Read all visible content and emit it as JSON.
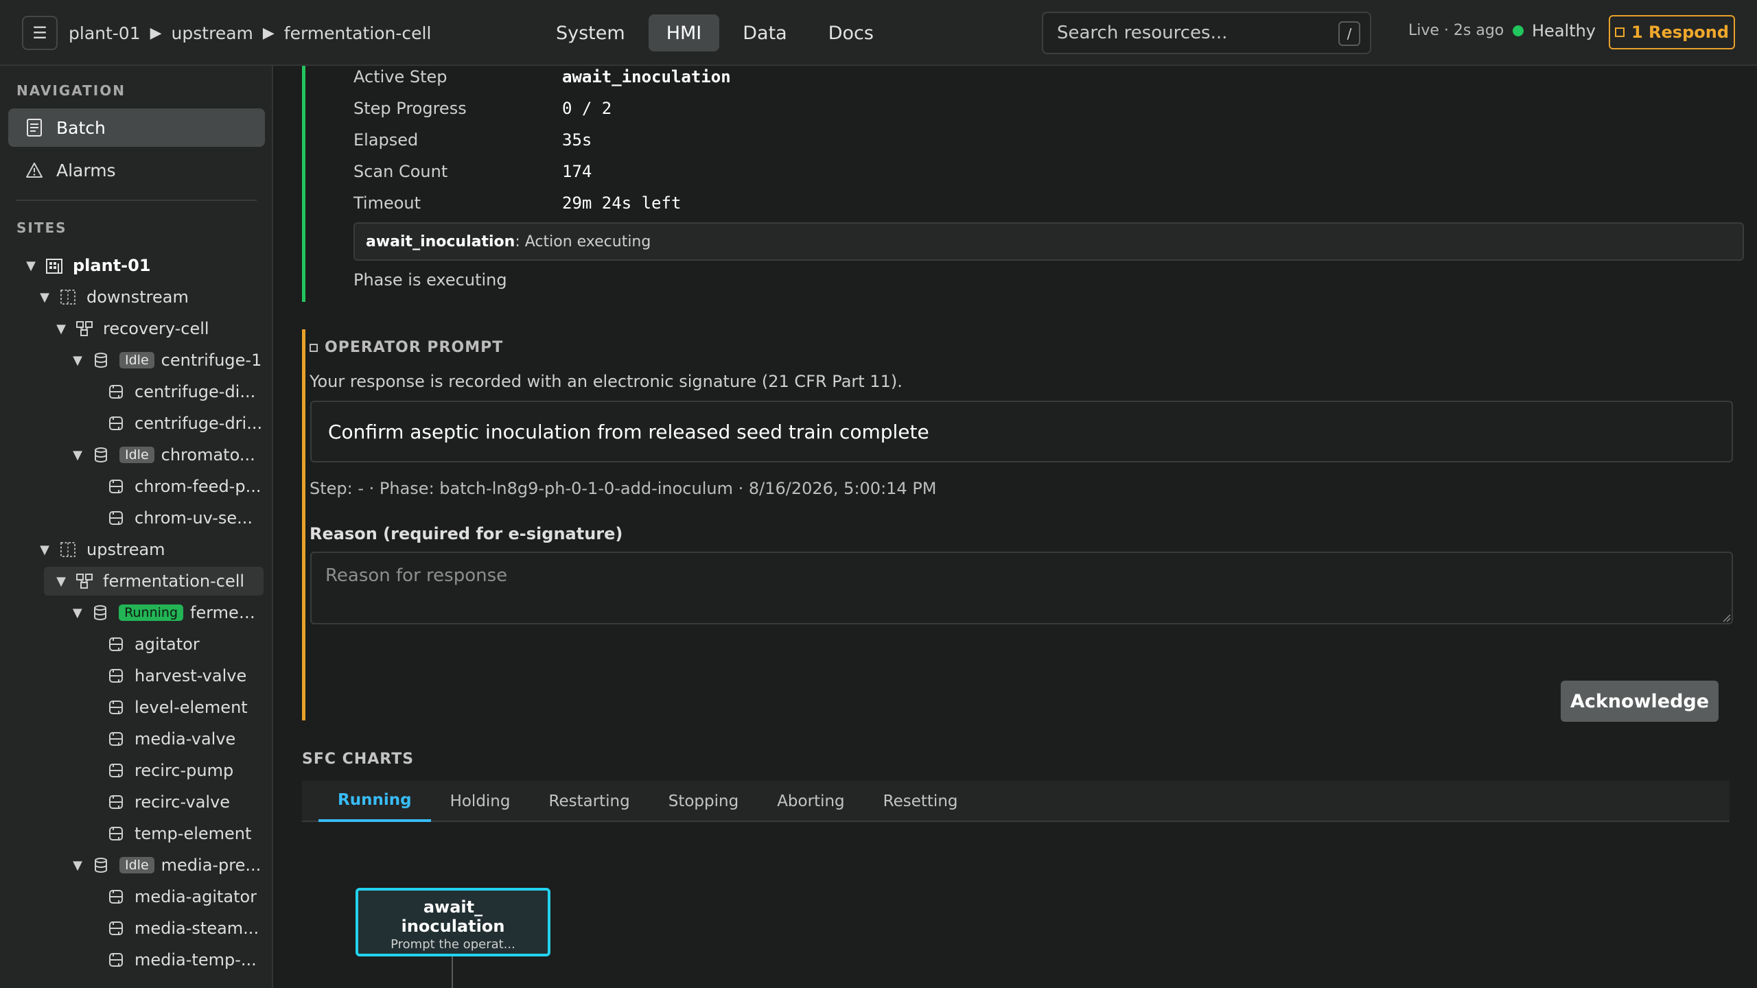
{
  "header": {
    "menu_icon": "☰",
    "breadcrumb": [
      "plant-01",
      "upstream",
      "fermentation-cell"
    ],
    "breadcrumb_sep": "▶",
    "tabs": [
      {
        "label": "System",
        "active": false
      },
      {
        "label": "HMI",
        "active": true
      },
      {
        "label": "Data",
        "active": false
      },
      {
        "label": "Docs",
        "active": false
      }
    ],
    "search": {
      "placeholder": "Search resources...",
      "shortcut": "/"
    },
    "live_status": "Live · 2s ago",
    "health": {
      "label": "Healthy",
      "color": "#22c55e"
    },
    "respond": {
      "count": "1",
      "label": "Respond",
      "color": "#f0a82c"
    }
  },
  "sidebar": {
    "nav_heading": "NAVIGATION",
    "nav": [
      {
        "label": "Batch",
        "icon": "document-icon",
        "active": true
      },
      {
        "label": "Alarms",
        "icon": "warning-icon",
        "active": false
      }
    ],
    "sites_heading": "SITES",
    "tree": [
      {
        "label": "plant-01",
        "type": "site"
      },
      {
        "label": "downstream",
        "type": "area"
      },
      {
        "label": "recovery-cell",
        "type": "cell"
      },
      {
        "label": "centrifuge-1",
        "type": "unit",
        "badge": "Idle"
      },
      {
        "label": "centrifuge-di...",
        "type": "module"
      },
      {
        "label": "centrifuge-dri...",
        "type": "module"
      },
      {
        "label": "chromato...",
        "type": "unit",
        "badge": "Idle"
      },
      {
        "label": "chrom-feed-p...",
        "type": "module"
      },
      {
        "label": "chrom-uv-se...",
        "type": "module"
      },
      {
        "label": "upstream",
        "type": "area"
      },
      {
        "label": "fermentation-cell",
        "type": "cell",
        "selected": true
      },
      {
        "label": "fermen...",
        "type": "unit",
        "badge": "Running"
      },
      {
        "label": "agitator",
        "type": "module"
      },
      {
        "label": "harvest-valve",
        "type": "module"
      },
      {
        "label": "level-element",
        "type": "module"
      },
      {
        "label": "media-valve",
        "type": "module"
      },
      {
        "label": "recirc-pump",
        "type": "module"
      },
      {
        "label": "recirc-valve",
        "type": "module"
      },
      {
        "label": "temp-element",
        "type": "module"
      },
      {
        "label": "media-pre...",
        "type": "unit",
        "badge": "Idle"
      },
      {
        "label": "media-agitator",
        "type": "module"
      },
      {
        "label": "media-steam...",
        "type": "module"
      },
      {
        "label": "media-temp-...",
        "type": "module"
      }
    ]
  },
  "phase": {
    "fields": [
      {
        "key": "Active Step",
        "value": "await_inoculation",
        "bold": true
      },
      {
        "key": "Step Progress",
        "value": "0 / 2"
      },
      {
        "key": "Elapsed",
        "value": "35s"
      },
      {
        "key": "Scan Count",
        "value": "174"
      },
      {
        "key": "Timeout",
        "value": "29m 24s left"
      }
    ],
    "message_step": "await_inoculation",
    "message_text": ": Action executing",
    "status": "Phase is executing",
    "accent": "#22c55e"
  },
  "prompt": {
    "heading": "OPERATOR PROMPT",
    "note": "Your response is recorded with an electronic signature (21 CFR Part 11).",
    "text": "Confirm aseptic inoculation from released seed train complete",
    "meta": "Step: - · Phase: batch-ln8g9-ph-0-1-0-add-inoculum · 8/16/2026, 5:00:14 PM",
    "reason_label": "Reason (required for e-signature)",
    "reason_placeholder": "Reason for response",
    "reason_value": "",
    "ack_label": "Acknowledge",
    "accent": "#e8a229"
  },
  "sfc": {
    "title": "SFC CHARTS",
    "tabs": [
      {
        "label": "Running",
        "active": true
      },
      {
        "label": "Holding",
        "active": false
      },
      {
        "label": "Restarting",
        "active": false
      },
      {
        "label": "Stopping",
        "active": false
      },
      {
        "label": "Aborting",
        "active": false
      },
      {
        "label": "Resetting",
        "active": false
      }
    ],
    "node": {
      "line1": "await_",
      "line2": "inoculation",
      "desc": "Prompt the operat..."
    },
    "accent": "#22d3ee"
  }
}
